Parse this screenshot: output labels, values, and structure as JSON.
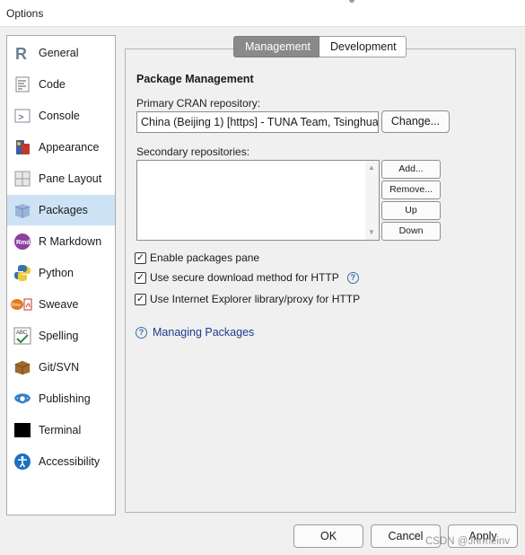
{
  "window": {
    "title": "Options"
  },
  "sidebar": {
    "items": [
      {
        "label": "General",
        "icon": "r-logo-icon"
      },
      {
        "label": "Code",
        "icon": "code-icon"
      },
      {
        "label": "Console",
        "icon": "console-icon"
      },
      {
        "label": "Appearance",
        "icon": "appearance-icon"
      },
      {
        "label": "Pane Layout",
        "icon": "pane-layout-icon"
      },
      {
        "label": "Packages",
        "icon": "packages-icon",
        "selected": true
      },
      {
        "label": "R Markdown",
        "icon": "rmd-icon"
      },
      {
        "label": "Python",
        "icon": "python-icon"
      },
      {
        "label": "Sweave",
        "icon": "sweave-icon"
      },
      {
        "label": "Spelling",
        "icon": "spelling-icon"
      },
      {
        "label": "Git/SVN",
        "icon": "git-svn-icon"
      },
      {
        "label": "Publishing",
        "icon": "publishing-icon"
      },
      {
        "label": "Terminal",
        "icon": "terminal-icon"
      },
      {
        "label": "Accessibility",
        "icon": "accessibility-icon"
      }
    ]
  },
  "tabs": {
    "management": "Management",
    "development": "Development"
  },
  "packages": {
    "heading": "Package Management",
    "cran_label": "Primary CRAN repository:",
    "cran_value": "China (Beijing 1) [https] - TUNA Team, Tsinghua",
    "change_button": "Change...",
    "secondary_label": "Secondary repositories:",
    "add_button": "Add...",
    "remove_button": "Remove...",
    "up_button": "Up",
    "down_button": "Down",
    "enable_pane": "Enable packages pane",
    "secure_download": "Use secure download method for HTTP",
    "ie_proxy": "Use Internet Explorer library/proxy for HTTP",
    "managing_link": "Managing Packages"
  },
  "footer": {
    "ok": "OK",
    "cancel": "Cancel",
    "apply": "Apply"
  },
  "watermark": "CSDN @Jnrmeinv",
  "colors": {
    "selected_bg": "#cde3f5",
    "active_tab": "#8a8a8a",
    "link": "#1f3a8f"
  }
}
